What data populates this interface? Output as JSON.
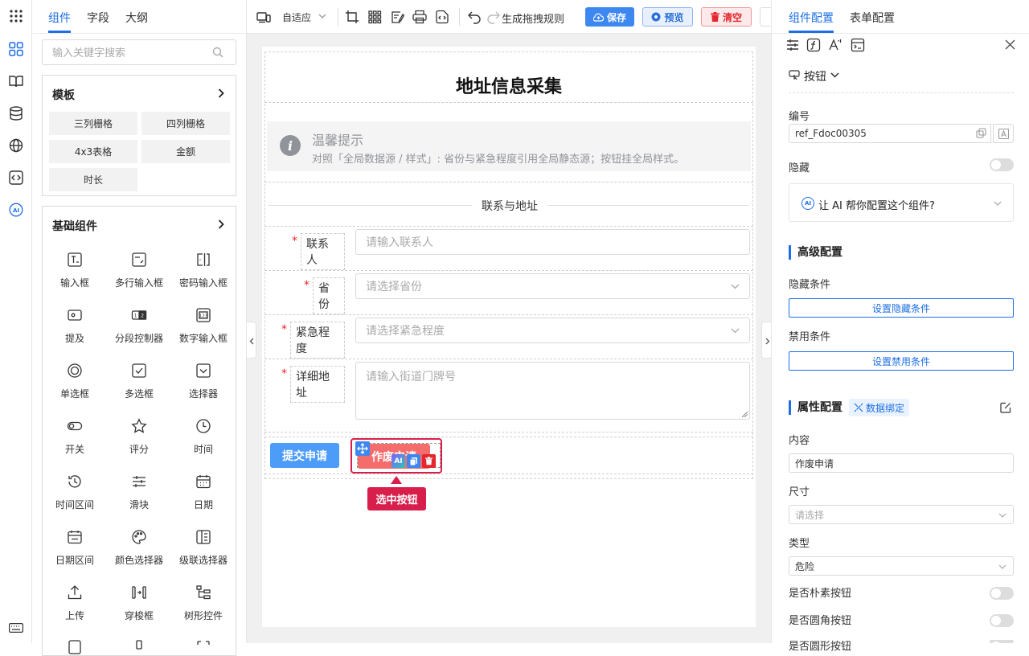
{
  "left_panel": {
    "tabs": [
      "组件",
      "字段",
      "大纲"
    ],
    "search_placeholder": "输入关键字搜索",
    "template_section": {
      "title": "模板",
      "items": [
        "三列栅格",
        "四列栅格",
        "4x3表格",
        "金额",
        "时长"
      ]
    },
    "basic_section": {
      "title": "基础组件",
      "items": [
        "输入框",
        "多行输入框",
        "密码输入框",
        "提及",
        "分段控制器",
        "数字输入框",
        "单选框",
        "多选框",
        "选择器",
        "开关",
        "评分",
        "时间",
        "时间区间",
        "滑块",
        "日期",
        "日期区间",
        "颜色选择器",
        "级联选择器",
        "上传",
        "穿梭框",
        "树形控件"
      ]
    }
  },
  "toolbar": {
    "device_mode": "自适应",
    "drag_rule": "生成拖拽规则",
    "save": "保存",
    "preview": "预览",
    "clear": "清空"
  },
  "form": {
    "title": "地址信息采集",
    "notice_title": "温馨提示",
    "notice_text": "对照「全局数据源 / 样式」: 省份与紧急程度引用全局静态源；按钮挂全局样式。",
    "divider_text": "联系与地址",
    "fields": [
      {
        "label": "联系人",
        "placeholder": "请输入联系人"
      },
      {
        "label": "省份",
        "placeholder": "请选择省份"
      },
      {
        "label": "紧急程度",
        "placeholder": "请选择紧急程度"
      },
      {
        "label": "详细地址",
        "placeholder": "请输入街道门牌号"
      }
    ],
    "submit_button": "提交申请",
    "void_button": "作废申请",
    "selected_tag": "选中按钮",
    "ai_badge": "AI"
  },
  "right_panel": {
    "tabs": [
      "组件配置",
      "表单配置"
    ],
    "component_type": "按钮",
    "id_label": "编号",
    "id_value": "ref_Fdoc00305",
    "hidden_label": "隐藏",
    "ai_prompt": "让 AI 帮你配置这个组件?",
    "ai_badge": "AI",
    "advanced_title": "高级配置",
    "hide_cond_label": "隐藏条件",
    "hide_cond_btn": "设置隐藏条件",
    "disable_cond_label": "禁用条件",
    "disable_cond_btn": "设置禁用条件",
    "props_title": "属性配置",
    "data_bind": "数据绑定",
    "content_label": "内容",
    "content_value": "作废申请",
    "size_label": "尺寸",
    "size_placeholder": "请选择",
    "type_label": "类型",
    "type_value": "危险",
    "plain_label": "是否朴素按钮",
    "round_label": "是否圆角按钮",
    "circle_label": "是否圆形按钮"
  },
  "colors": {
    "accent": "#1e6fe6",
    "danger": "#e5262d",
    "selected": "#d81e4a",
    "submit": "#4d9cf8",
    "void": "#f56c6c"
  }
}
